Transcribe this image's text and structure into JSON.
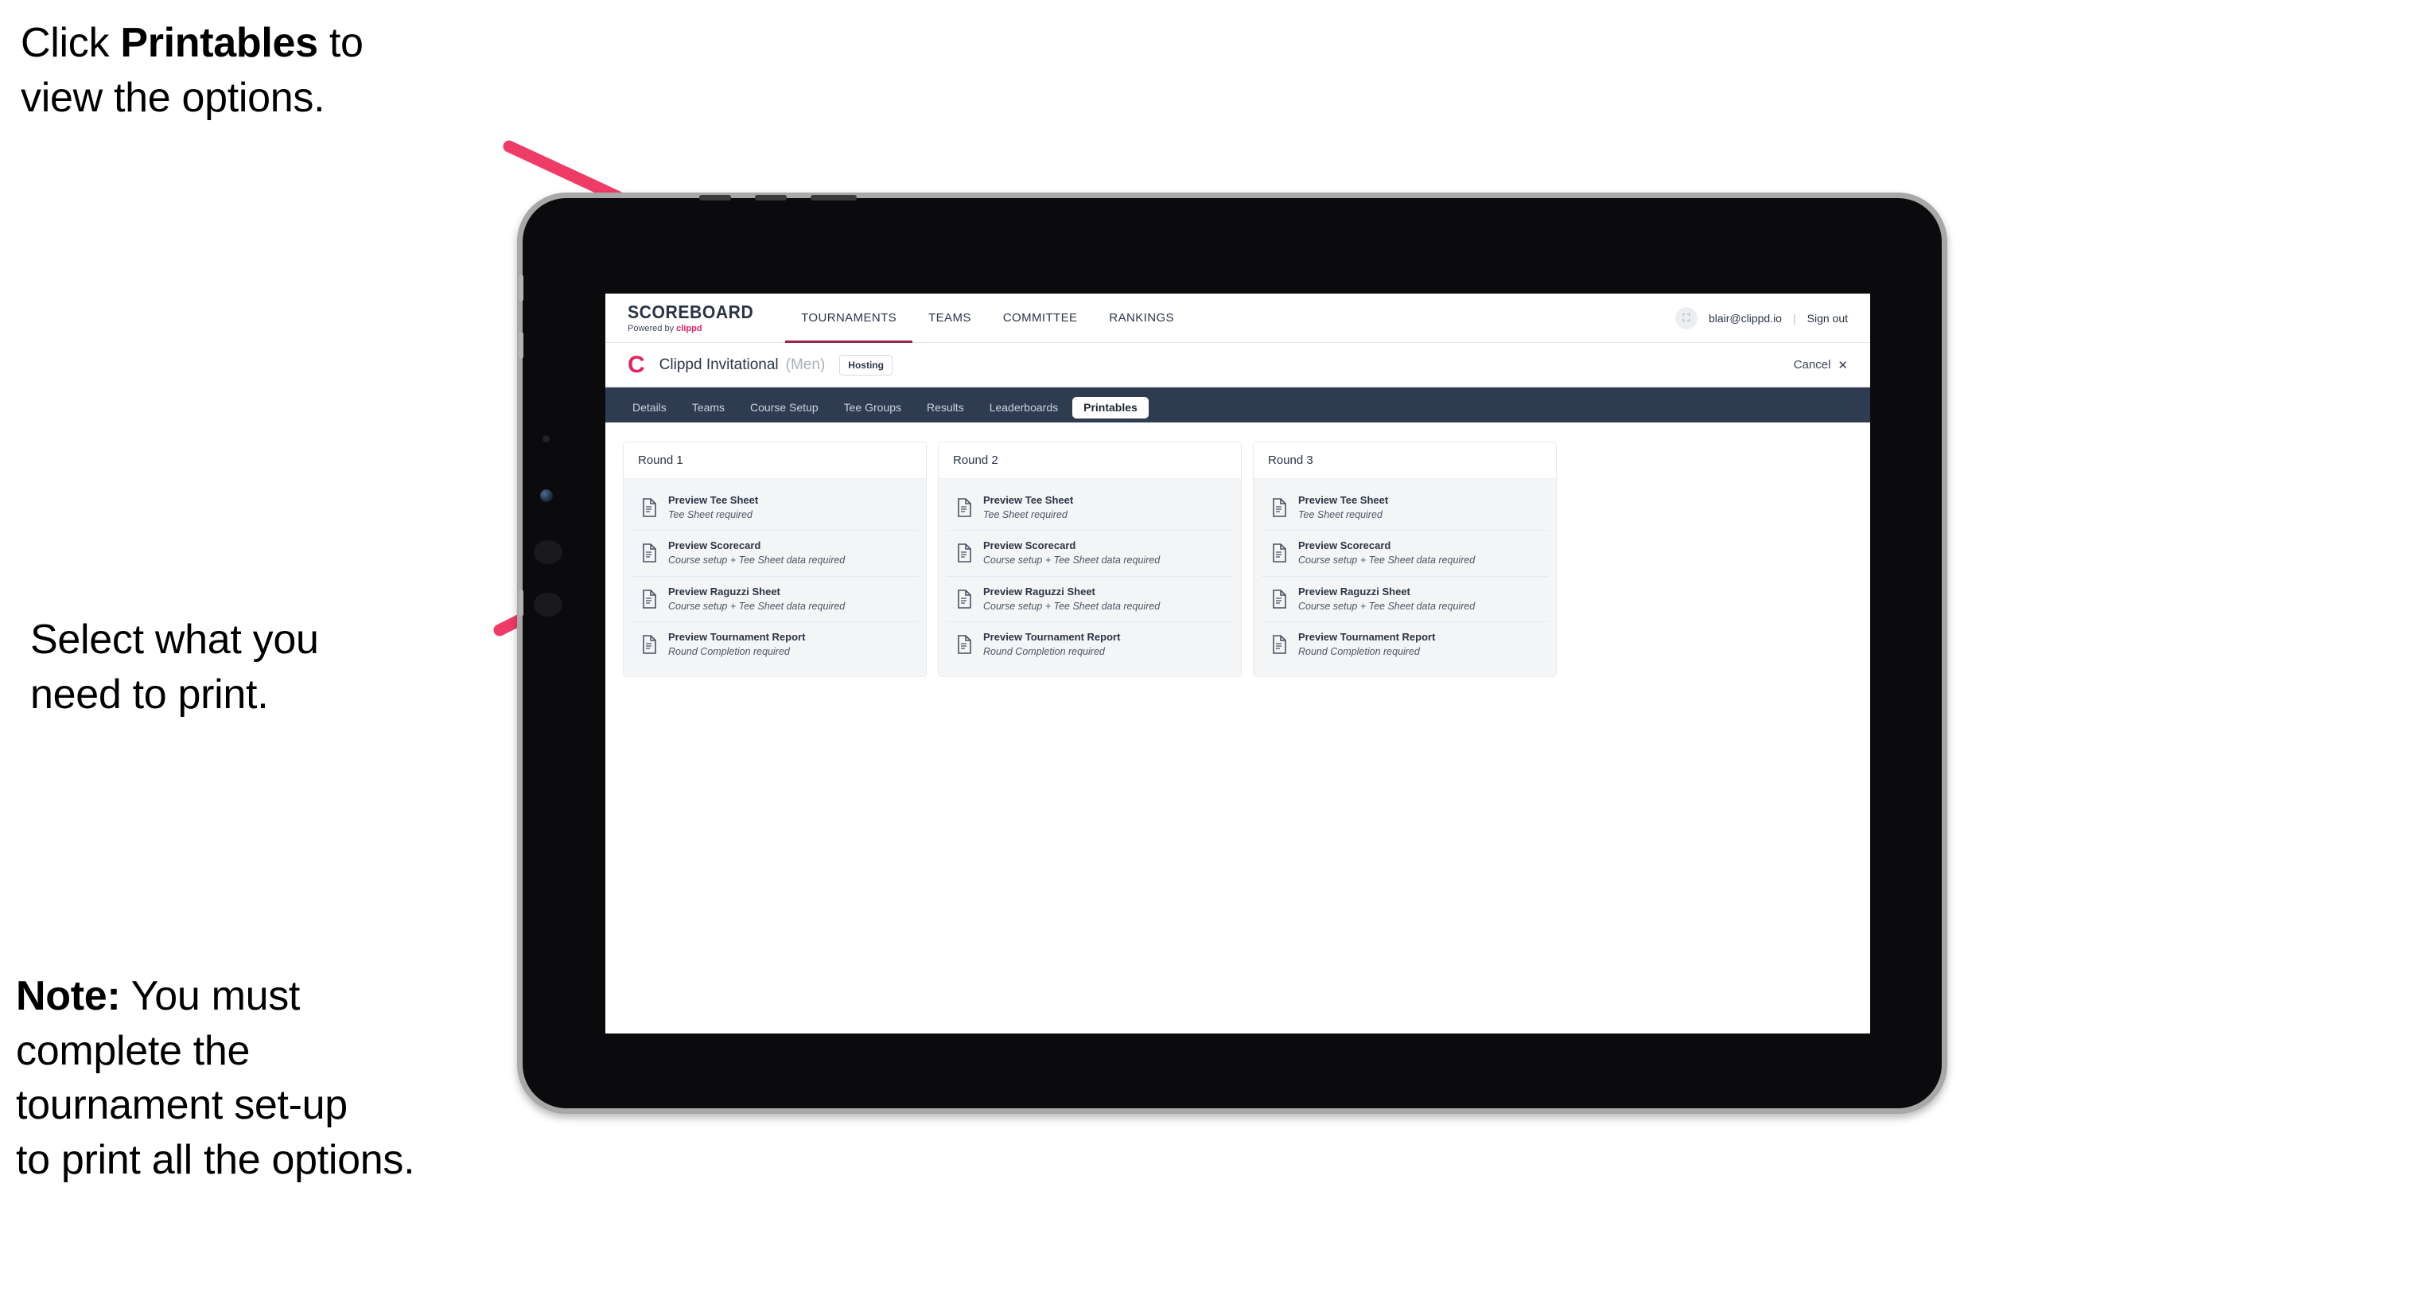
{
  "annotations": {
    "click_printables": {
      "prefix": "Click ",
      "bold": "Printables",
      "suffix": " to\nview the options."
    },
    "select_print": "Select what you\n need to print.",
    "note": {
      "bold": "Note:",
      "rest": " You must\ncomplete the\ntournament set-up\nto print all the options."
    }
  },
  "colors": {
    "arrow": "#ef3c67",
    "accent": "#e2245d",
    "nav_active_underline": "#9c2448",
    "tabbar_bg": "#2e3b50"
  },
  "app": {
    "brand": {
      "title": "SCOREBOARD",
      "powered_prefix": "Powered by ",
      "powered_brand": "clippd"
    },
    "nav_links": [
      {
        "label": "TOURNAMENTS",
        "active": true
      },
      {
        "label": "TEAMS",
        "active": false
      },
      {
        "label": "COMMITTEE",
        "active": false
      },
      {
        "label": "RANKINGS",
        "active": false
      }
    ],
    "account": {
      "avatar_glyph": "⛶",
      "email": "blair@clippd.io",
      "separator": "|",
      "sign_out": "Sign out"
    },
    "tournament": {
      "logo_letter": "C",
      "name": "Clippd Invitational",
      "gender": "(Men)",
      "badge": "Hosting",
      "cancel": "Cancel",
      "cancel_icon": "✕"
    },
    "tabs": [
      {
        "label": "Details",
        "active": false
      },
      {
        "label": "Teams",
        "active": false
      },
      {
        "label": "Course Setup",
        "active": false
      },
      {
        "label": "Tee Groups",
        "active": false
      },
      {
        "label": "Results",
        "active": false
      },
      {
        "label": "Leaderboards",
        "active": false
      },
      {
        "label": "Printables",
        "active": true
      }
    ],
    "rounds": [
      {
        "title": "Round 1",
        "items": [
          {
            "title": "Preview Tee Sheet",
            "sub": "Tee Sheet required"
          },
          {
            "title": "Preview Scorecard",
            "sub": "Course setup + Tee Sheet data required"
          },
          {
            "title": "Preview Raguzzi Sheet",
            "sub": "Course setup + Tee Sheet data required"
          },
          {
            "title": "Preview Tournament Report",
            "sub": "Round Completion required"
          }
        ]
      },
      {
        "title": "Round 2",
        "items": [
          {
            "title": "Preview Tee Sheet",
            "sub": "Tee Sheet required"
          },
          {
            "title": "Preview Scorecard",
            "sub": "Course setup + Tee Sheet data required"
          },
          {
            "title": "Preview Raguzzi Sheet",
            "sub": "Course setup + Tee Sheet data required"
          },
          {
            "title": "Preview Tournament Report",
            "sub": "Round Completion required"
          }
        ]
      },
      {
        "title": "Round 3",
        "items": [
          {
            "title": "Preview Tee Sheet",
            "sub": "Tee Sheet required"
          },
          {
            "title": "Preview Scorecard",
            "sub": "Course setup + Tee Sheet data required"
          },
          {
            "title": "Preview Raguzzi Sheet",
            "sub": "Course setup + Tee Sheet data required"
          },
          {
            "title": "Preview Tournament Report",
            "sub": "Round Completion required"
          }
        ]
      }
    ]
  }
}
